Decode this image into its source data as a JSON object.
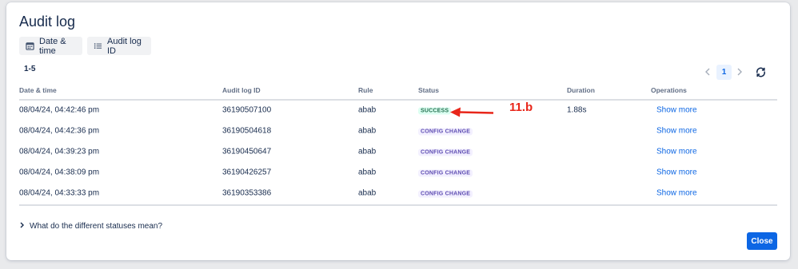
{
  "modal": {
    "title": "Audit log",
    "filters": [
      {
        "label": "Date & time",
        "icon": "calendar-icon"
      },
      {
        "label": "Audit log ID",
        "icon": "list-icon"
      }
    ],
    "range_label": "1-5",
    "pagination": {
      "current_page": "1"
    },
    "table": {
      "headers": [
        "Date & time",
        "Audit log ID",
        "Rule",
        "Status",
        "Duration",
        "Operations"
      ],
      "rows": [
        {
          "date": "08/04/24, 04:42:46 pm",
          "id": "36190507100",
          "rule": "abab",
          "status": "SUCCESS",
          "duration": "1.88s",
          "operation": "Show more"
        },
        {
          "date": "08/04/24, 04:42:36 pm",
          "id": "36190504618",
          "rule": "abab",
          "status": "CONFIG CHANGE",
          "duration": "",
          "operation": "Show more"
        },
        {
          "date": "08/04/24, 04:39:23 pm",
          "id": "36190450647",
          "rule": "abab",
          "status": "CONFIG CHANGE",
          "duration": "",
          "operation": "Show more"
        },
        {
          "date": "08/04/24, 04:38:09 pm",
          "id": "36190426257",
          "rule": "abab",
          "status": "CONFIG CHANGE",
          "duration": "",
          "operation": "Show more"
        },
        {
          "date": "08/04/24, 04:33:33 pm",
          "id": "36190353386",
          "rule": "abab",
          "status": "CONFIG CHANGE",
          "duration": "",
          "operation": "Show more"
        }
      ]
    },
    "faq_label": "What do the different statuses mean?",
    "close_label": "Close"
  },
  "annotation": {
    "label": "11.b",
    "color": "#e8261a"
  },
  "colors": {
    "primary": "#0c66e4",
    "success_bg": "#dcfff1",
    "success_text": "#216e4e",
    "config_bg": "#f3f0ff",
    "config_text": "#5e4db2"
  }
}
